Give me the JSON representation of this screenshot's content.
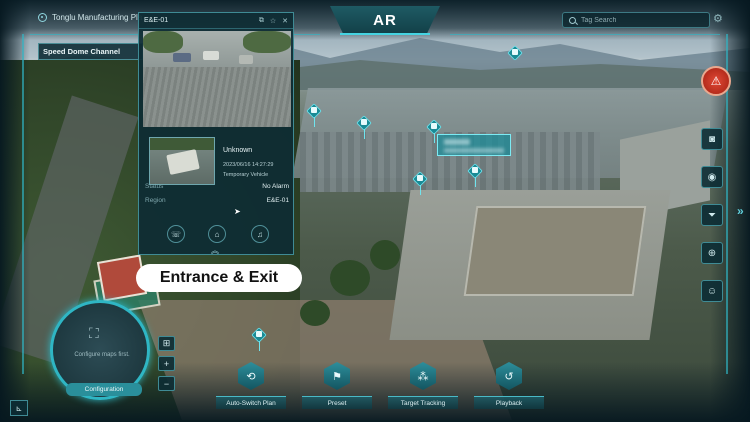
{
  "app": {
    "title": "Tonglu Manufacturing Pla"
  },
  "header": {
    "mode_tab": "AR"
  },
  "search": {
    "placeholder": "Tag Search"
  },
  "channel": {
    "label": "Speed Dome Channel"
  },
  "panel": {
    "title": "E&E-01",
    "record": {
      "name": "Unknown",
      "timestamp": "2023/06/16 14:27:29",
      "type": "Temporary Vehicle"
    },
    "fields": [
      {
        "key": "Status",
        "value": "No Alarm"
      },
      {
        "key": "Region",
        "value": "E&E-01"
      }
    ]
  },
  "caption": "Entrance & Exit",
  "map_widget": {
    "text": "Configure maps first.",
    "button": "Configuration"
  },
  "actions": [
    {
      "label": "Auto-Switch Plan",
      "icon": "refresh-icon"
    },
    {
      "label": "Preset",
      "icon": "flag-icon"
    },
    {
      "label": "Target Tracking",
      "icon": "footprints-icon"
    },
    {
      "label": "Playback",
      "icon": "playback-icon"
    }
  ],
  "tools": [
    "camera-icon",
    "record-icon",
    "filter-icon",
    "zoom-target-icon",
    "person-icon"
  ],
  "colors": {
    "accent": "#2fb6c4",
    "panel_bg": "#0e2c34",
    "alarm": "#d93f2e"
  }
}
